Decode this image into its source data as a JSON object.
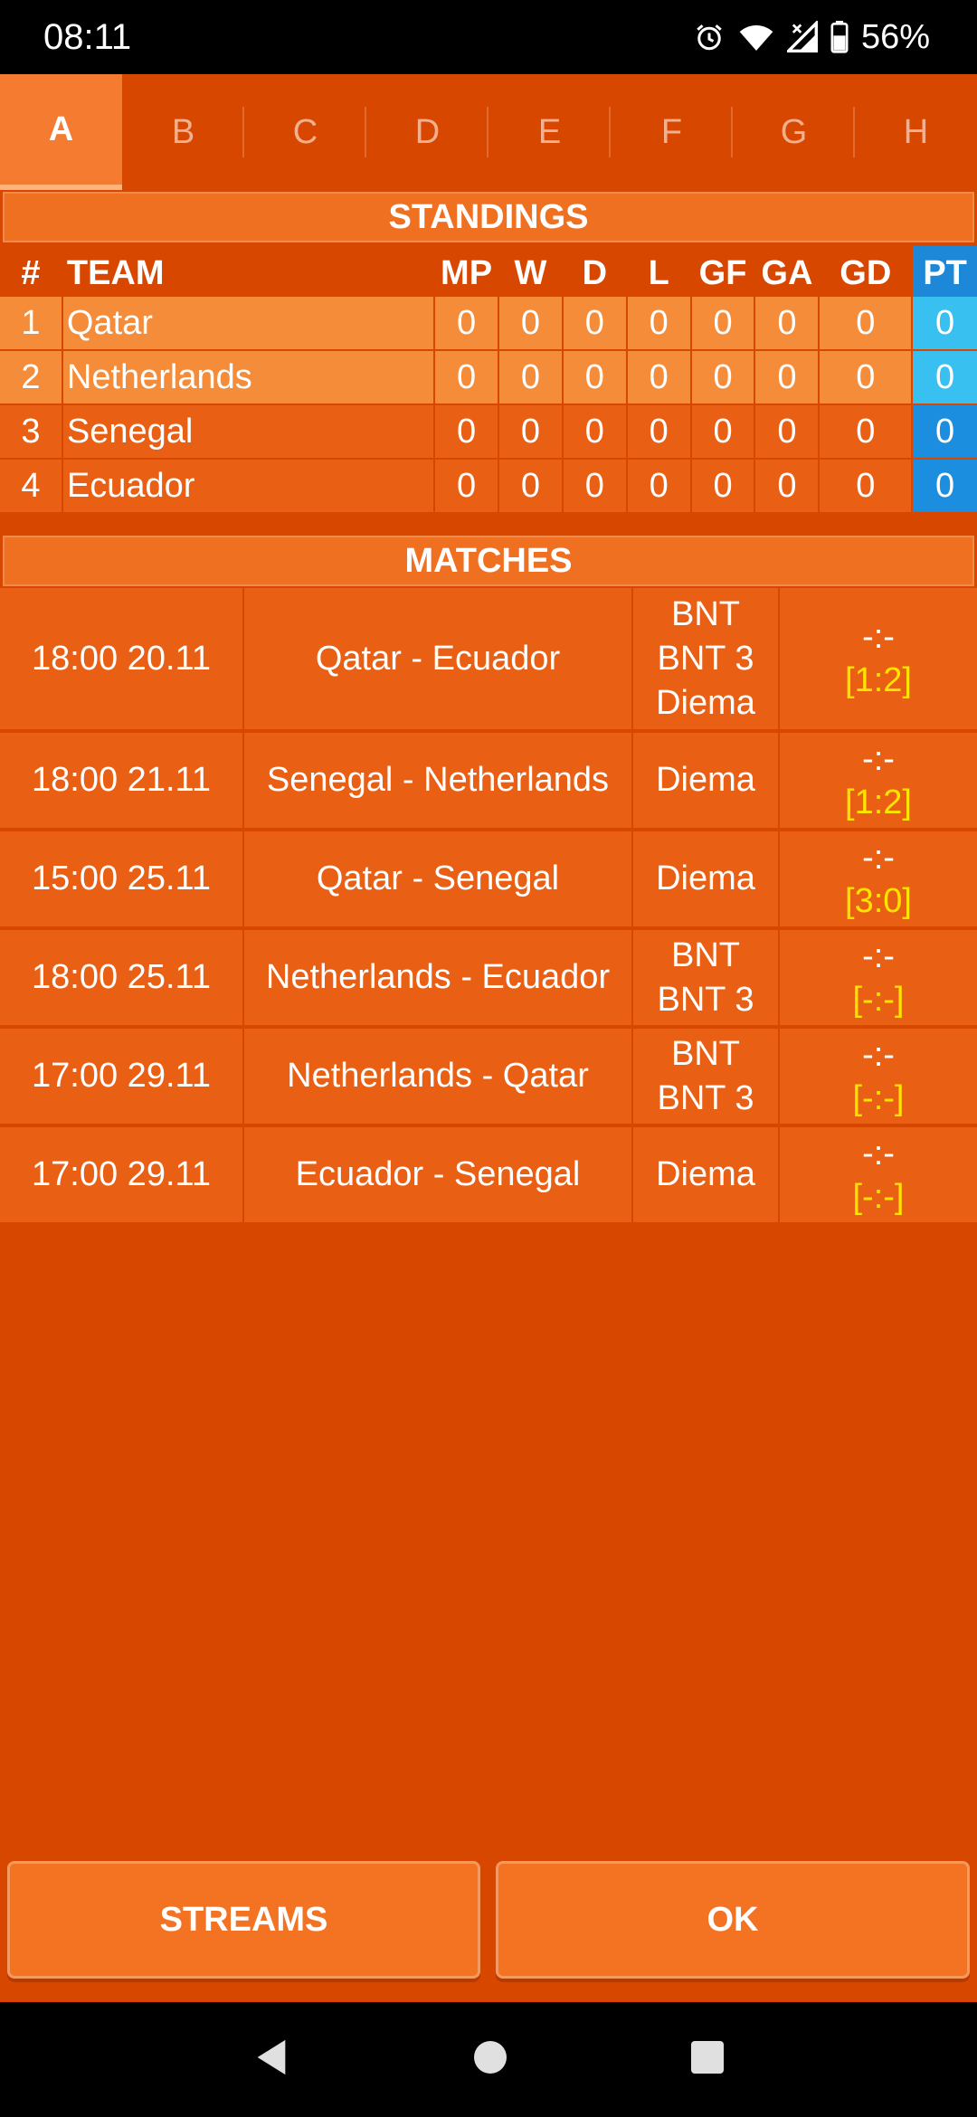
{
  "status": {
    "time": "08:11",
    "battery": "56%"
  },
  "tabs": [
    "A",
    "B",
    "C",
    "D",
    "E",
    "F",
    "G",
    "H"
  ],
  "standings": {
    "title": "STANDINGS",
    "headers": {
      "pos": "#",
      "team": "TEAM",
      "mp": "MP",
      "w": "W",
      "d": "D",
      "l": "L",
      "gf": "GF",
      "ga": "GA",
      "gd": "GD",
      "pt": "PT"
    },
    "rows": [
      {
        "pos": "1",
        "team": "Qatar",
        "mp": "0",
        "w": "0",
        "d": "0",
        "l": "0",
        "gf": "0",
        "ga": "0",
        "gd": "0",
        "pt": "0"
      },
      {
        "pos": "2",
        "team": "Netherlands",
        "mp": "0",
        "w": "0",
        "d": "0",
        "l": "0",
        "gf": "0",
        "ga": "0",
        "gd": "0",
        "pt": "0"
      },
      {
        "pos": "3",
        "team": "Senegal",
        "mp": "0",
        "w": "0",
        "d": "0",
        "l": "0",
        "gf": "0",
        "ga": "0",
        "gd": "0",
        "pt": "0"
      },
      {
        "pos": "4",
        "team": "Ecuador",
        "mp": "0",
        "w": "0",
        "d": "0",
        "l": "0",
        "gf": "0",
        "ga": "0",
        "gd": "0",
        "pt": "0"
      }
    ]
  },
  "matches": {
    "title": "MATCHES",
    "rows": [
      {
        "time": "18:00 20.11",
        "teams": "Qatar - Ecuador",
        "tv": [
          "BNT",
          "BNT 3",
          "Diema"
        ],
        "result": "-:-",
        "prediction": "[1:2]"
      },
      {
        "time": "18:00 21.11",
        "teams": "Senegal - Netherlands",
        "tv": [
          "Diema"
        ],
        "result": "-:-",
        "prediction": "[1:2]"
      },
      {
        "time": "15:00 25.11",
        "teams": "Qatar - Senegal",
        "tv": [
          "Diema"
        ],
        "result": "-:-",
        "prediction": "[3:0]"
      },
      {
        "time": "18:00 25.11",
        "teams": "Netherlands - Ecuador",
        "tv": [
          "BNT",
          "BNT 3"
        ],
        "result": "-:-",
        "prediction": "[-:-]"
      },
      {
        "time": "17:00 29.11",
        "teams": "Netherlands - Qatar",
        "tv": [
          "BNT",
          "BNT 3"
        ],
        "result": "-:-",
        "prediction": "[-:-]"
      },
      {
        "time": "17:00 29.11",
        "teams": "Ecuador - Senegal",
        "tv": [
          "Diema"
        ],
        "result": "-:-",
        "prediction": "[-:-]"
      }
    ]
  },
  "buttons": {
    "streams": "STREAMS",
    "ok": "OK"
  },
  "colors": {
    "background": "#d84700",
    "accent": "#f47b30",
    "points_highlight": "#37c0f0",
    "points_normal": "#1b8ee0",
    "prediction": "#ffe400"
  }
}
